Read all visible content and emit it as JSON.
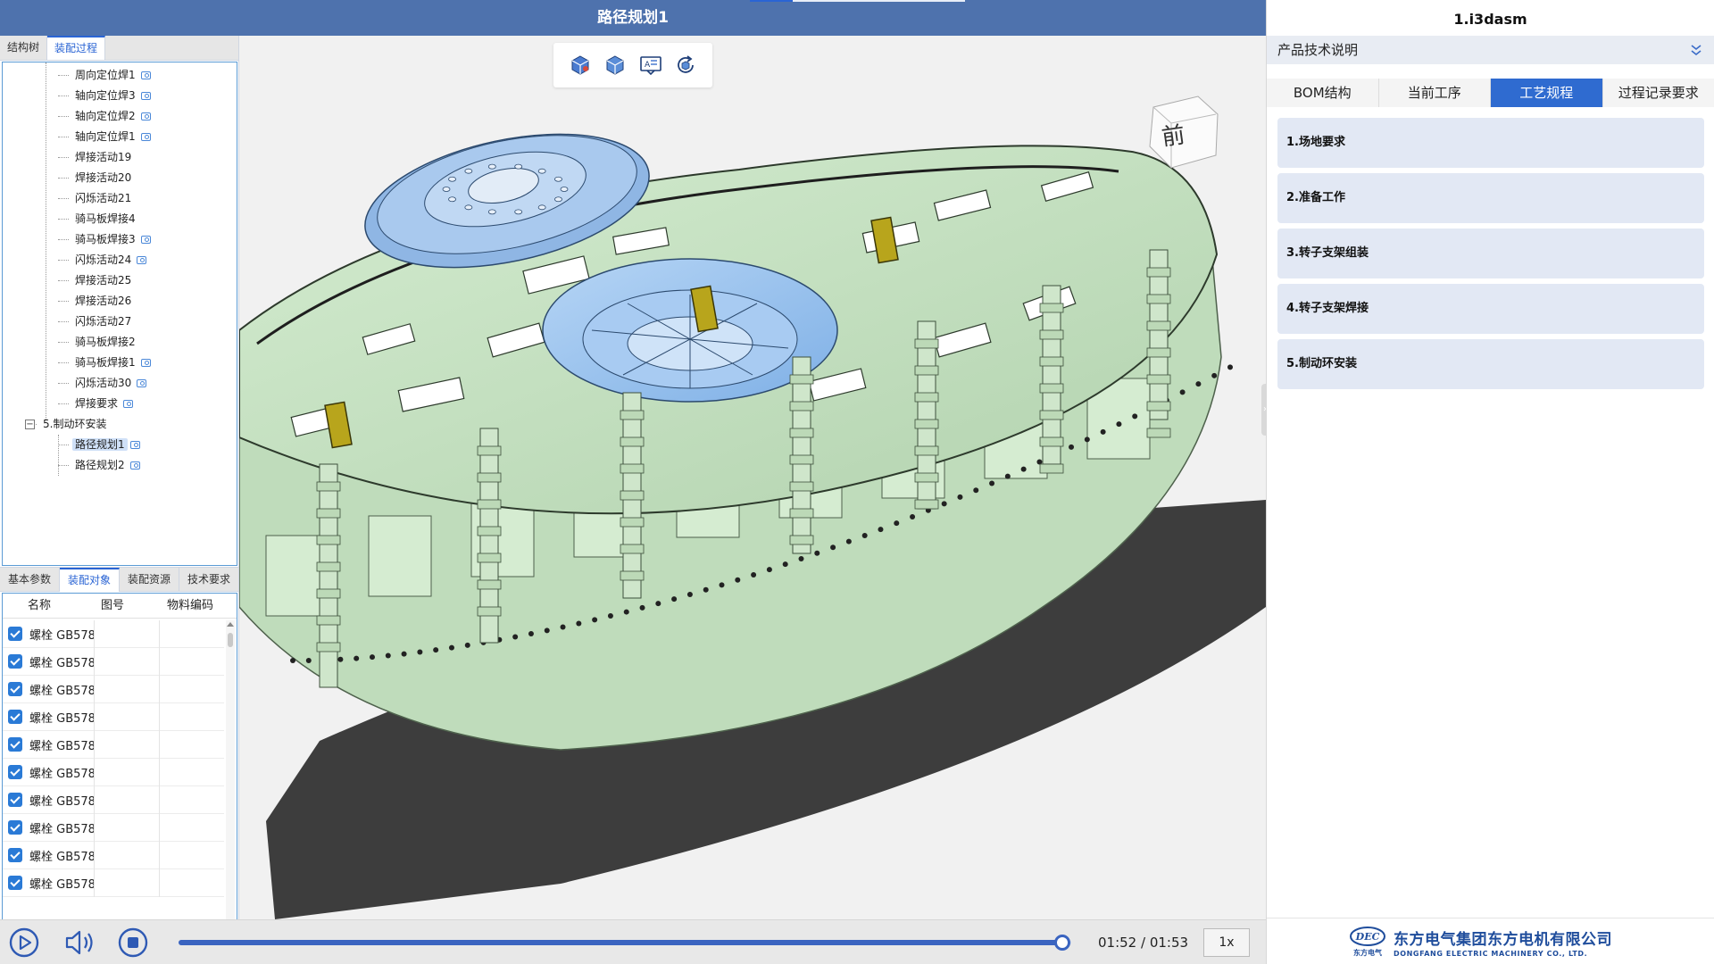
{
  "header": {
    "title": "路径规划1"
  },
  "left_panel": {
    "tabs": [
      {
        "label": "结构树",
        "active": false
      },
      {
        "label": "装配过程",
        "active": true
      }
    ],
    "tree_items": [
      {
        "label": "周向定位焊1",
        "level": 2,
        "has_camera": true,
        "selected": false
      },
      {
        "label": "轴向定位焊3",
        "level": 2,
        "has_camera": true,
        "selected": false
      },
      {
        "label": "轴向定位焊2",
        "level": 2,
        "has_camera": true,
        "selected": false
      },
      {
        "label": "轴向定位焊1",
        "level": 2,
        "has_camera": true,
        "selected": false
      },
      {
        "label": "焊接活动19",
        "level": 2,
        "has_camera": false,
        "selected": false
      },
      {
        "label": "焊接活动20",
        "level": 2,
        "has_camera": false,
        "selected": false
      },
      {
        "label": "闪烁活动21",
        "level": 2,
        "has_camera": false,
        "selected": false
      },
      {
        "label": "骑马板焊接4",
        "level": 2,
        "has_camera": false,
        "selected": false
      },
      {
        "label": "骑马板焊接3",
        "level": 2,
        "has_camera": true,
        "selected": false
      },
      {
        "label": "闪烁活动24",
        "level": 2,
        "has_camera": true,
        "selected": false
      },
      {
        "label": "焊接活动25",
        "level": 2,
        "has_camera": false,
        "selected": false
      },
      {
        "label": "焊接活动26",
        "level": 2,
        "has_camera": false,
        "selected": false
      },
      {
        "label": "闪烁活动27",
        "level": 2,
        "has_camera": false,
        "selected": false
      },
      {
        "label": "骑马板焊接2",
        "level": 2,
        "has_camera": false,
        "selected": false
      },
      {
        "label": "骑马板焊接1",
        "level": 2,
        "has_camera": true,
        "selected": false
      },
      {
        "label": "闪烁活动30",
        "level": 2,
        "has_camera": true,
        "selected": false
      },
      {
        "label": "焊接要求",
        "level": 2,
        "has_camera": true,
        "selected": false
      },
      {
        "label": "5.制动环安装",
        "level": 1,
        "has_camera": false,
        "selected": false,
        "expanded": true
      },
      {
        "label": "路径规划1",
        "level": 2,
        "has_camera": true,
        "selected": true
      },
      {
        "label": "路径规划2",
        "level": 2,
        "has_camera": true,
        "selected": false
      }
    ],
    "bottom_tabs": [
      {
        "label": "基本参数",
        "active": false
      },
      {
        "label": "装配对象",
        "active": true
      },
      {
        "label": "装配资源",
        "active": false
      },
      {
        "label": "技术要求",
        "active": false
      }
    ],
    "table": {
      "columns": [
        "名称",
        "图号",
        "物料编码"
      ],
      "rows": [
        {
          "checked": true,
          "name": "螺栓 GB578"
        },
        {
          "checked": true,
          "name": "螺栓 GB578"
        },
        {
          "checked": true,
          "name": "螺栓 GB578"
        },
        {
          "checked": true,
          "name": "螺栓 GB578"
        },
        {
          "checked": true,
          "name": "螺栓 GB578"
        },
        {
          "checked": true,
          "name": "螺栓 GB578"
        },
        {
          "checked": true,
          "name": "螺栓 GB578"
        },
        {
          "checked": true,
          "name": "螺栓 GB578"
        },
        {
          "checked": true,
          "name": "螺栓 GB578"
        },
        {
          "checked": true,
          "name": "螺栓 GB578"
        }
      ]
    }
  },
  "viewport": {
    "toolbar_icons": [
      "view-cube-icon",
      "isometric-view-icon",
      "annotation-icon",
      "reset-view-icon"
    ],
    "view_cube_label": "前",
    "model_colors": {
      "frame": "#c6e3c2",
      "frame_edge": "#5a6d58",
      "hub": "#9cc4ef",
      "brake_ring": "#3f3f3f",
      "clamp": "#b8a51c"
    }
  },
  "player": {
    "elapsed": "01:52",
    "total": "01:53",
    "progress": 0.99,
    "speed": "1x",
    "accent_color": "#3a64c0"
  },
  "right_panel": {
    "file_title": "1.i3dasm",
    "section_title": "产品技术说明",
    "tabs": [
      {
        "label": "BOM结构",
        "active": false
      },
      {
        "label": "当前工序",
        "active": false
      },
      {
        "label": "工艺规程",
        "active": true
      },
      {
        "label": "过程记录要求",
        "active": false
      }
    ],
    "cards": [
      {
        "label": "1.场地要求"
      },
      {
        "label": "2.准备工作"
      },
      {
        "label": "3.转子支架组装"
      },
      {
        "label": "4.转子支架焊接"
      },
      {
        "label": "5.制动环安装"
      }
    ],
    "footer": {
      "logo_mark": "DEC",
      "logo_sub": "东方电气",
      "company_cn": "东方电气集团东方电机有限公司",
      "company_en": "DONGFANG ELECTRIC MACHINERY CO., LTD."
    }
  }
}
